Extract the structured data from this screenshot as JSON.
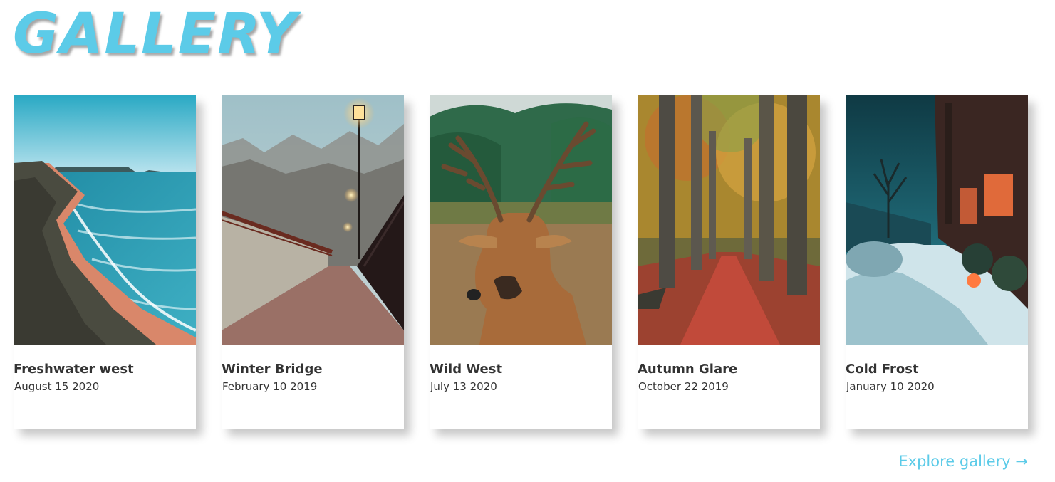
{
  "page": {
    "title": "GALLERY",
    "accent_color": "#5ccbe8"
  },
  "gallery": {
    "cards": [
      {
        "title": "Freshwater west",
        "date": "August 15 2020",
        "image": "coastal-cliff-beach-photo"
      },
      {
        "title": "Winter Bridge",
        "date": "February 10 2019",
        "image": "snowy-bridge-streetlamp-photo"
      },
      {
        "title": "Wild West",
        "date": "July 13 2020",
        "image": "deer-antlers-photo"
      },
      {
        "title": "Autumn Glare",
        "date": "October 22 2019",
        "image": "autumn-forest-path-photo"
      },
      {
        "title": "Cold Frost",
        "date": "January 10 2020",
        "image": "snowy-street-night-photo"
      }
    ]
  },
  "footer": {
    "explore_label": "Explore gallery →"
  }
}
